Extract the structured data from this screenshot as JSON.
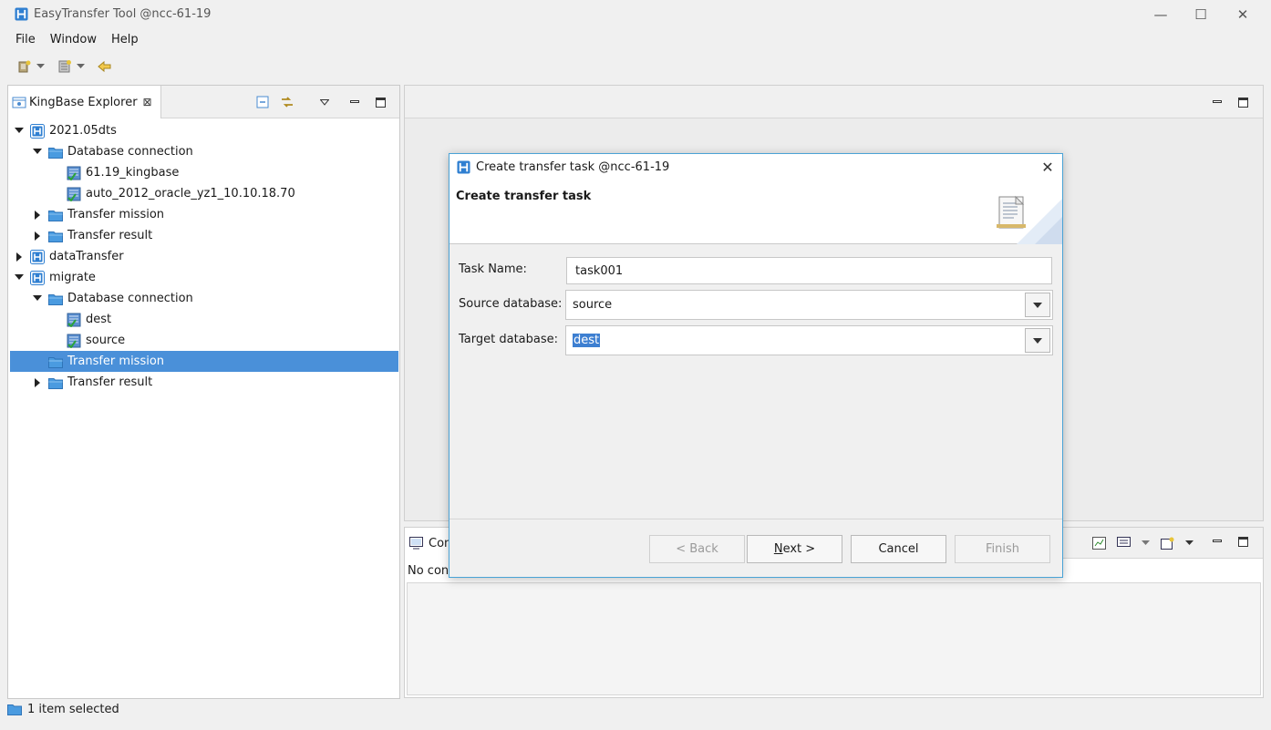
{
  "window": {
    "title": "EasyTransfer Tool @ncc-61-19",
    "minimize": "—",
    "maximize": "☐",
    "close": "✕"
  },
  "menu": [
    "File",
    "Window",
    "Help"
  ],
  "explorer": {
    "tab_label": "KingBase Explorer",
    "tab_close": "⊠",
    "tree": [
      {
        "label": "2021.05dts",
        "level": 0,
        "expanded": true,
        "icon": "project-icon"
      },
      {
        "label": "Database connection",
        "level": 1,
        "expanded": true,
        "icon": "folder-icon"
      },
      {
        "label": "61.19_kingbase",
        "level": 2,
        "icon": "db-connection-icon"
      },
      {
        "label": "auto_2012_oracle_yz1_10.10.18.70",
        "level": 2,
        "icon": "db-connection-icon"
      },
      {
        "label": "Transfer mission",
        "level": 1,
        "expanded": false,
        "icon": "folder-icon"
      },
      {
        "label": "Transfer result",
        "level": 1,
        "expanded": false,
        "icon": "folder-icon"
      },
      {
        "label": "dataTransfer",
        "level": 0,
        "expanded": false,
        "icon": "project-icon"
      },
      {
        "label": "migrate",
        "level": 0,
        "expanded": true,
        "icon": "project-icon"
      },
      {
        "label": "Database connection",
        "level": 1,
        "expanded": true,
        "icon": "folder-icon"
      },
      {
        "label": "dest",
        "level": 2,
        "icon": "db-connection-icon"
      },
      {
        "label": "source",
        "level": 2,
        "icon": "db-connection-icon"
      },
      {
        "label": "Transfer mission",
        "level": 1,
        "selected": true,
        "icon": "folder-icon"
      },
      {
        "label": "Transfer result",
        "level": 1,
        "expanded": false,
        "icon": "folder-icon"
      }
    ]
  },
  "console": {
    "tab_label": "Con",
    "body_text": "No con"
  },
  "status": {
    "text": "1 item selected"
  },
  "dialog": {
    "title": "Create transfer task @ncc-61-19",
    "close": "✕",
    "banner_title": "Create transfer task",
    "task_name_label": "Task Name:",
    "task_name_value": "task001",
    "source_label": "Source database:",
    "source_value": "source",
    "target_label": "Target database:",
    "target_value": "dest",
    "buttons": {
      "back": "< Back",
      "next_mnemonic": "N",
      "next_rest": "ext >",
      "cancel": "Cancel",
      "finish": "Finish"
    }
  },
  "colors": {
    "selection": "#4a90d9",
    "dialog_border": "#4aa3d6",
    "folder": "#4a9be0"
  }
}
